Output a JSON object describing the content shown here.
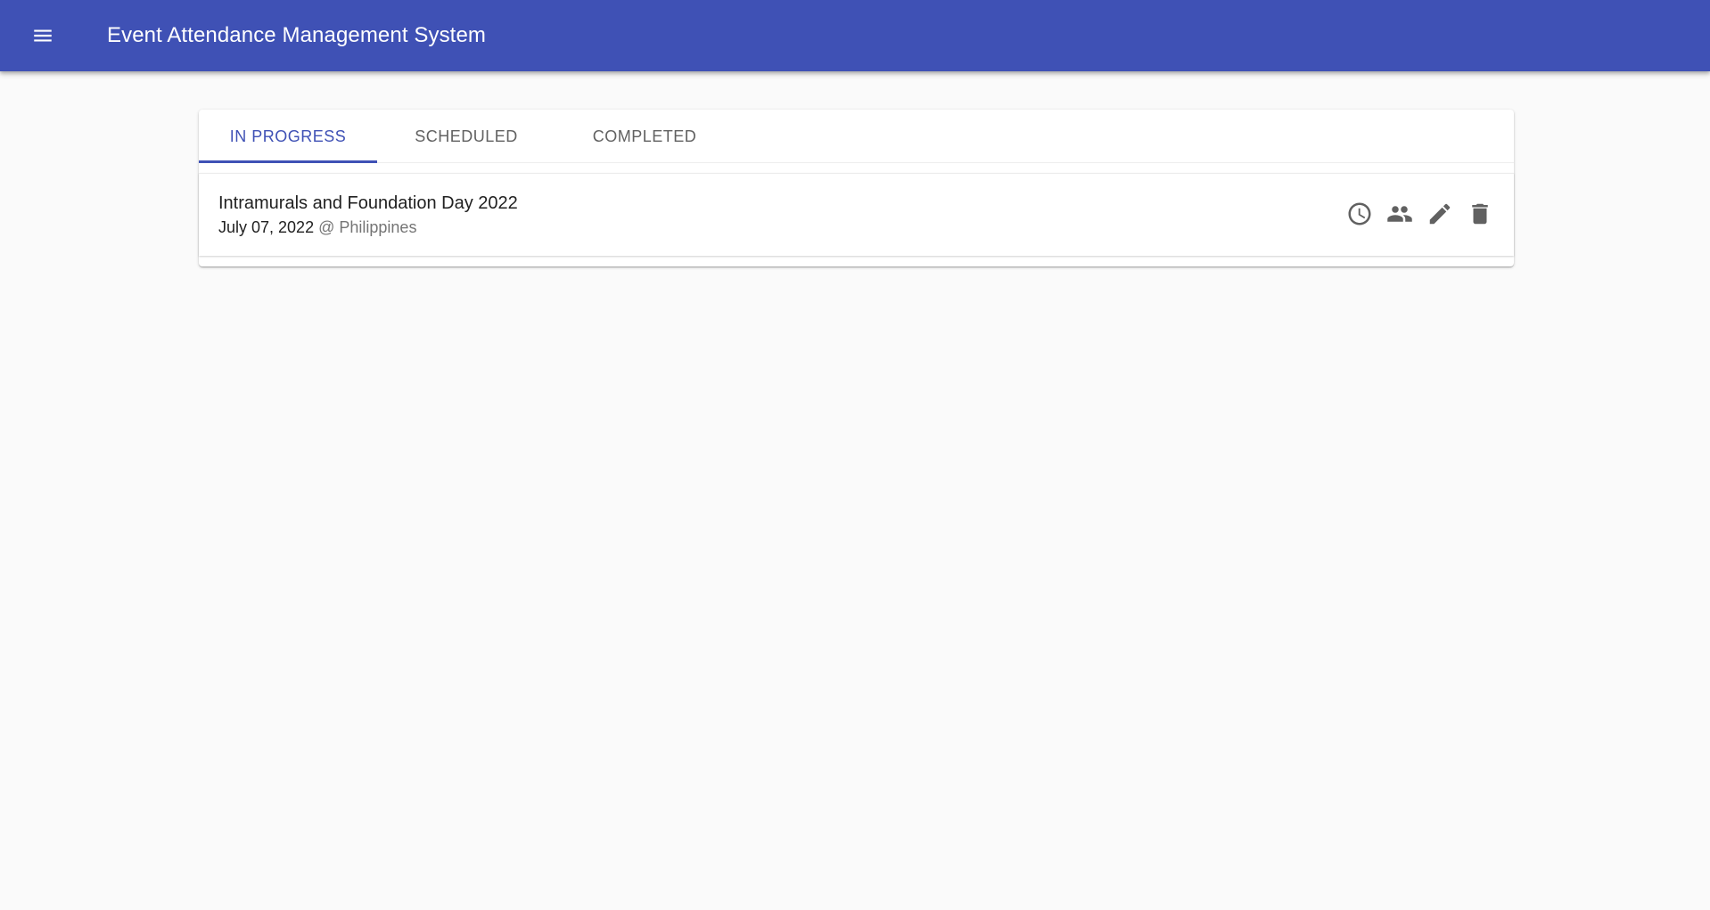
{
  "app_bar": {
    "title": "Event Attendance Management System",
    "menu_icon": "hamburger-menu-icon",
    "color": "#3f51b5"
  },
  "tabs": [
    {
      "label": "IN PROGRESS",
      "active": true
    },
    {
      "label": "SCHEDULED",
      "active": false
    },
    {
      "label": "COMPLETED",
      "active": false
    }
  ],
  "events": [
    {
      "title": "Intramurals and Foundation Day 2022",
      "date": "July 07, 2022",
      "separator": "@",
      "location": "Philippines",
      "actions": [
        {
          "icon": "clock-icon"
        },
        {
          "icon": "people-icon"
        },
        {
          "icon": "pencil-icon"
        },
        {
          "icon": "trash-icon"
        }
      ]
    }
  ],
  "colors": {
    "accent": "#3f51b5",
    "background": "#fafafa",
    "icon": "#616161"
  }
}
